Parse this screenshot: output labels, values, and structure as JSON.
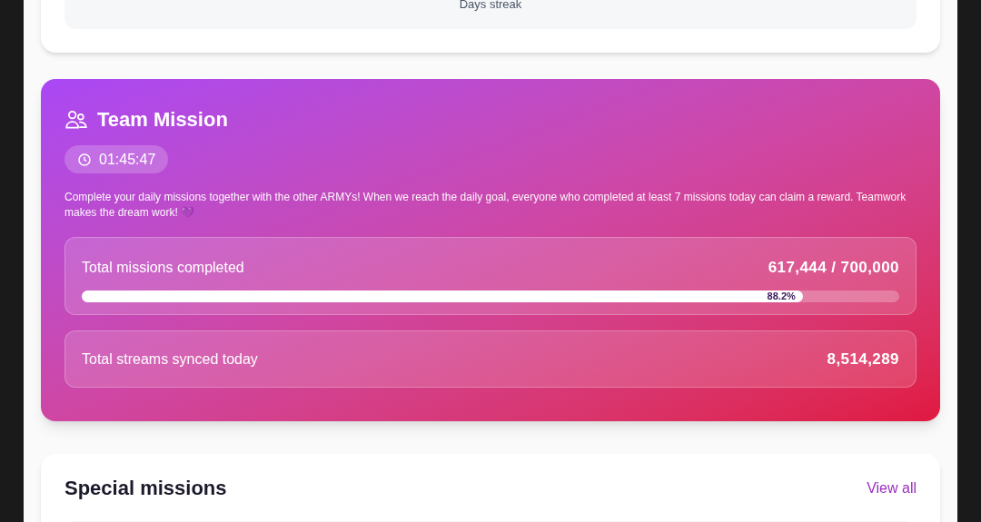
{
  "streak_card": {
    "label": "Days streak"
  },
  "team_mission": {
    "title": "Team Mission",
    "timer": "01:45:47",
    "description": "Complete your daily missions together with the other ARMYs! When we reach the daily goal, everyone who completed at least 7 missions today can claim a reward. Teamwork makes the dream work! 💜",
    "missions": {
      "label": "Total missions completed",
      "value": "617,444 / 700,000",
      "level": 0.882,
      "percent": "88.2%"
    },
    "streams": {
      "label": "Total streams synced today",
      "value": "8,514,289"
    }
  },
  "special_missions": {
    "title": "Special missions",
    "link": "View all"
  }
}
